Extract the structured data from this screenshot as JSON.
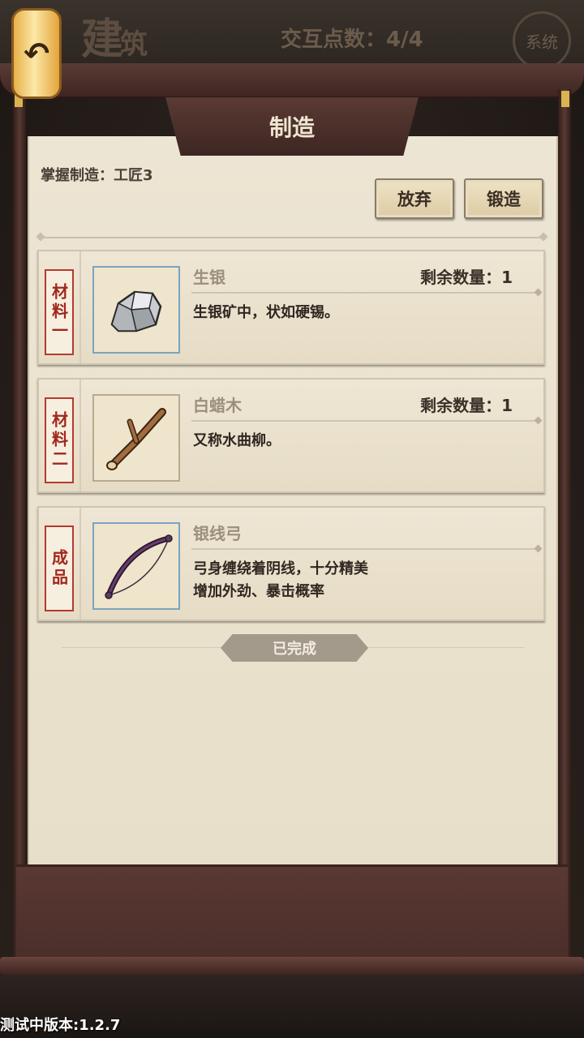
{
  "header": {
    "scene_title": "建",
    "scene_title_small": "筑",
    "interaction_points": "交互点数：4/4",
    "system_button": "系统",
    "back_glyph": "↶"
  },
  "panel": {
    "title": "制造",
    "mastery": "掌握制造：工匠3",
    "abandon_label": "放弃",
    "forge_label": "锻造"
  },
  "items": [
    {
      "tag": "材料一",
      "name": "生银",
      "quantity": "剩余数量：1",
      "desc1": "生银矿中，状如硬锡。",
      "icon": "silver-ore-icon"
    },
    {
      "tag": "材料二",
      "name": "白蜡木",
      "quantity": "剩余数量：1",
      "desc1": "又称水曲柳。",
      "icon": "ash-wood-branch-icon"
    },
    {
      "tag": "成品",
      "name": "银线弓",
      "quantity": "",
      "desc1": "弓身缠绕着阴线，十分精美",
      "desc2": "增加外劲、暴击概率",
      "icon": "bow-icon"
    }
  ],
  "status": {
    "completed": "已完成"
  },
  "footer": {
    "version": "测试中版本:1.2.7"
  }
}
